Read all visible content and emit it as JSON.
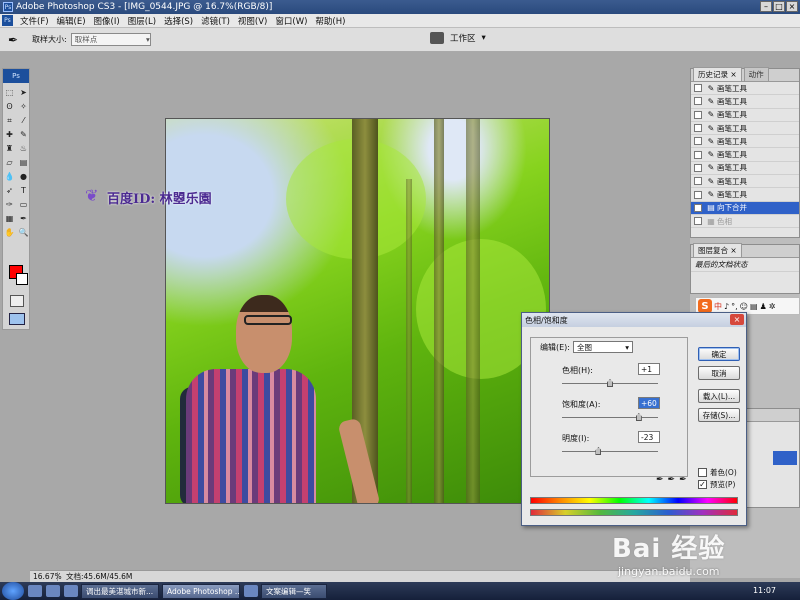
{
  "window": {
    "title": "Adobe Photoshop CS3 - [IMG_0544.JPG @ 16.7%(RGB/8)]",
    "app_icon": "Ps"
  },
  "menu": [
    "文件(F)",
    "编辑(E)",
    "图像(I)",
    "图层(L)",
    "选择(S)",
    "滤镜(T)",
    "视图(V)",
    "窗口(W)",
    "帮助(H)"
  ],
  "options": {
    "sample_size_label": "取样大小:",
    "sample_size_value": "取样点",
    "workspace_label": "工作区"
  },
  "watermark_text": "百度ID: 林曌乐園",
  "history_panel": {
    "tabs": [
      "历史记录",
      "动作"
    ],
    "items": [
      "画笔工具",
      "画笔工具",
      "画笔工具",
      "画笔工具",
      "画笔工具",
      "画笔工具",
      "画笔工具",
      "画笔工具",
      "画笔工具"
    ],
    "selected": "向下合并",
    "dim": "色相"
  },
  "layer_comps_panel": {
    "tab": "图层复合",
    "item": "最后的文档状态"
  },
  "dialog": {
    "title": "色相/饱和度",
    "edit_label": "编辑(E):",
    "edit_value": "全图",
    "hue": {
      "label": "色相(H):",
      "value": "+1",
      "level": 0.5
    },
    "saturation": {
      "label": "饱和度(A):",
      "value": "+60",
      "level": 0.8
    },
    "lightness": {
      "label": "明度(I):",
      "value": "-23",
      "level": 0.38
    },
    "buttons": {
      "ok": "确定",
      "cancel": "取消",
      "load": "载入(L)...",
      "save": "存储(S)..."
    },
    "colorize_label": "着色(O)",
    "preview_label": "预览(P)",
    "preview_checked": "✓"
  },
  "status": {
    "zoom": "16.67%",
    "doc": "文档:45.6M/45.6M"
  },
  "watermark_brand": {
    "logo": "Bai 经验",
    "url": "jingyan.baidu.com"
  },
  "taskbar": {
    "tasks": [
      "调出最美湛城市新...",
      "Adobe Photoshop ...",
      "文案编辑—笑"
    ],
    "clock": "11:07"
  },
  "colors": {
    "foreground": "#ff0000",
    "selection": "#2f61c8",
    "dialog_title_gradient": "#c5cfe0"
  }
}
